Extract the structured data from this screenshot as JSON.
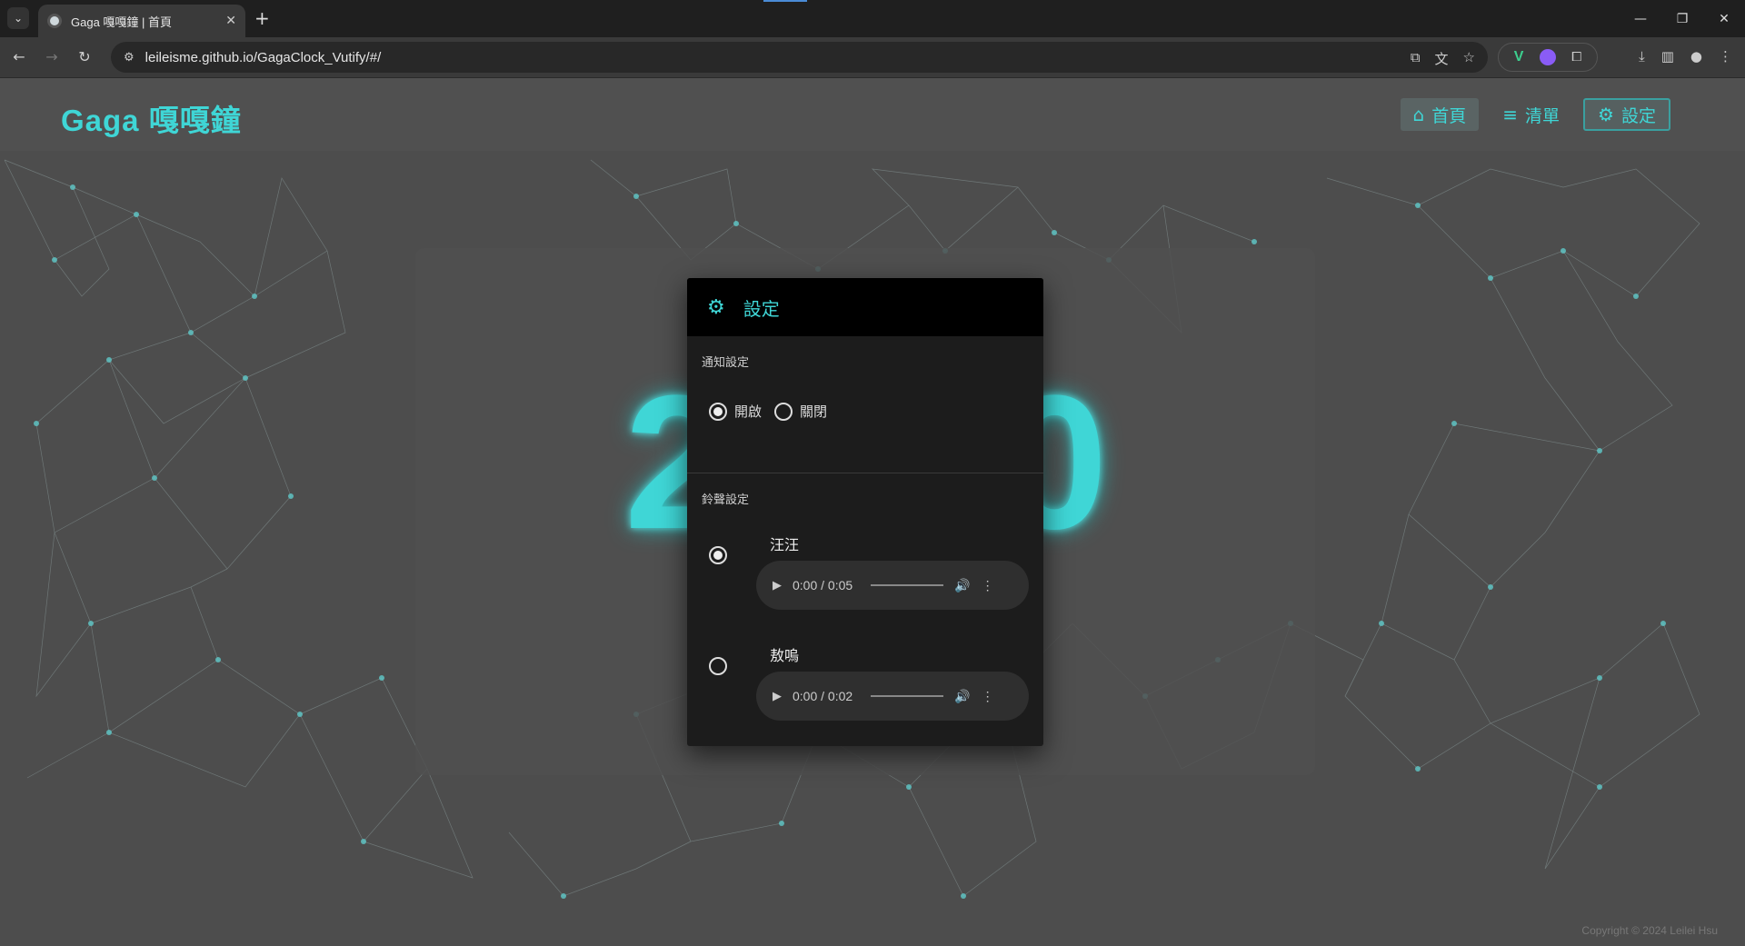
{
  "browser": {
    "tab_title": "Gaga 嘎嘎鐘 | 首頁",
    "url": "leileisme.github.io/GagaClock_Vutify/#/"
  },
  "app": {
    "title": "Gaga 嘎嘎鐘",
    "nav": {
      "home": "首頁",
      "list": "清單",
      "settings": "設定"
    },
    "clock_left": "2",
    "clock_right": "0",
    "footer": "Copyright © 2024 Leilei Hsu"
  },
  "dialog": {
    "title": "設定",
    "notify_label": "通知設定",
    "notify_on": "開啟",
    "notify_off": "關閉",
    "ring_label": "鈴聲設定",
    "rings": [
      {
        "name": "汪汪",
        "time": "0:00 / 0:05",
        "selected": true
      },
      {
        "name": "敖嗚",
        "time": "0:00 / 0:02",
        "selected": false
      }
    ]
  },
  "colors": {
    "accent": "#3fd6d6",
    "dialog_bg": "#1c1c1c",
    "page_bg": "#4d4d4d"
  }
}
